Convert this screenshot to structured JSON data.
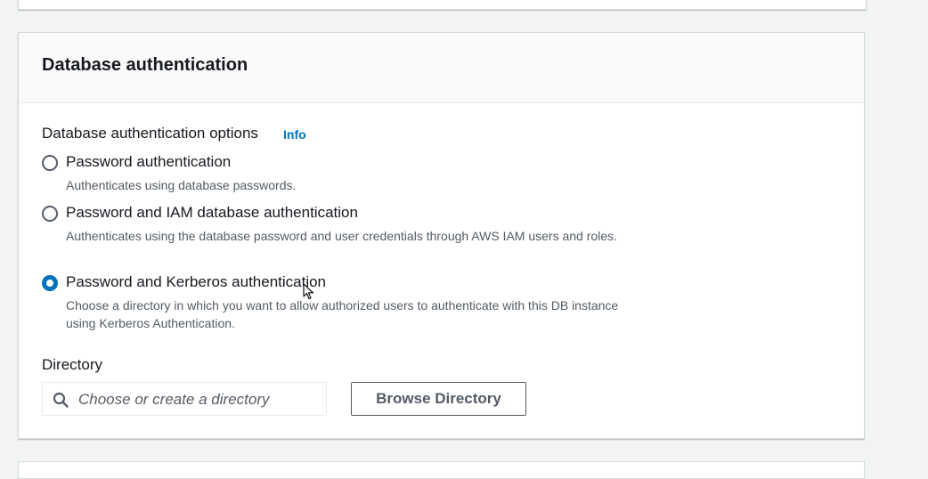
{
  "section": {
    "title": "Database authentication"
  },
  "auth_options": {
    "label": "Database authentication options",
    "info_link": "Info",
    "selected": "password-kerberos",
    "options": [
      {
        "id": "password",
        "label": "Password authentication",
        "description": "Authenticates using database passwords.",
        "checked": false
      },
      {
        "id": "password-iam",
        "label": "Password and IAM database authentication",
        "description": "Authenticates using the database password and user credentials through AWS IAM users and roles.",
        "checked": false
      },
      {
        "id": "password-kerberos",
        "label": "Password and Kerberos authentication",
        "description": "Choose a directory in which you want to allow authorized users to authenticate with this DB instance using Kerberos Authentication.",
        "checked": true
      }
    ]
  },
  "directory": {
    "label": "Directory",
    "placeholder": "Choose or create a directory",
    "browse_button": "Browse Directory"
  },
  "colors": {
    "accent": "#0073bb",
    "text": "#16191f",
    "secondary_text": "#545b64",
    "background": "#f2f3f3"
  },
  "icons": {
    "search": "search-icon",
    "cursor": "mouse-pointer-icon"
  }
}
